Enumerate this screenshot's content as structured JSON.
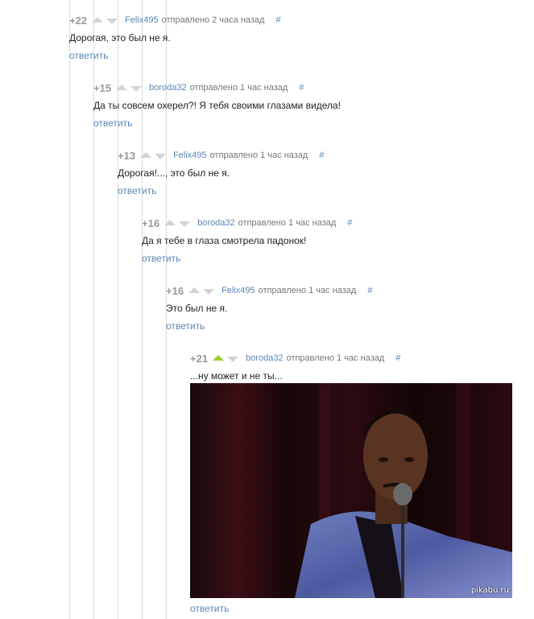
{
  "comments": [
    {
      "rating": "+22",
      "author": "Felix495",
      "time": "отправлено 2 часа назад",
      "hash": "#",
      "text": "Дорогая, это был не я.",
      "reply": "ответить",
      "upvoted": false
    },
    {
      "rating": "+15",
      "author": "boroda32",
      "time": "отправлено 1 час назад",
      "hash": "#",
      "text": "Да ты совсем охерел?! Я тебя своими глазами видела!",
      "reply": "ответить",
      "upvoted": false
    },
    {
      "rating": "+13",
      "author": "Felix495",
      "time": "отправлено 1 час назад",
      "hash": "#",
      "text": "Дорогая!..., это был не я.",
      "reply": "ответить",
      "upvoted": false
    },
    {
      "rating": "+16",
      "author": "boroda32",
      "time": "отправлено 1 час назад",
      "hash": "#",
      "text": "Да я тебе в глаза смотрела падонок!",
      "reply": "ответить",
      "upvoted": false
    },
    {
      "rating": "+16",
      "author": "Felix495",
      "time": "отправлено 1 час назад",
      "hash": "#",
      "text": "Это был не я.",
      "reply": "ответить",
      "upvoted": false
    },
    {
      "rating": "+21",
      "author": "boroda32",
      "time": "отправлено 1 час назад",
      "hash": "#",
      "text": "...ну может и не ты...",
      "reply": "ответить",
      "upvoted": true
    }
  ],
  "watermark": "pikabu.ru",
  "colors": {
    "link": "#5b85b5",
    "upvote_active": "#9acd32",
    "vote_inactive": "#d3d3d3"
  }
}
